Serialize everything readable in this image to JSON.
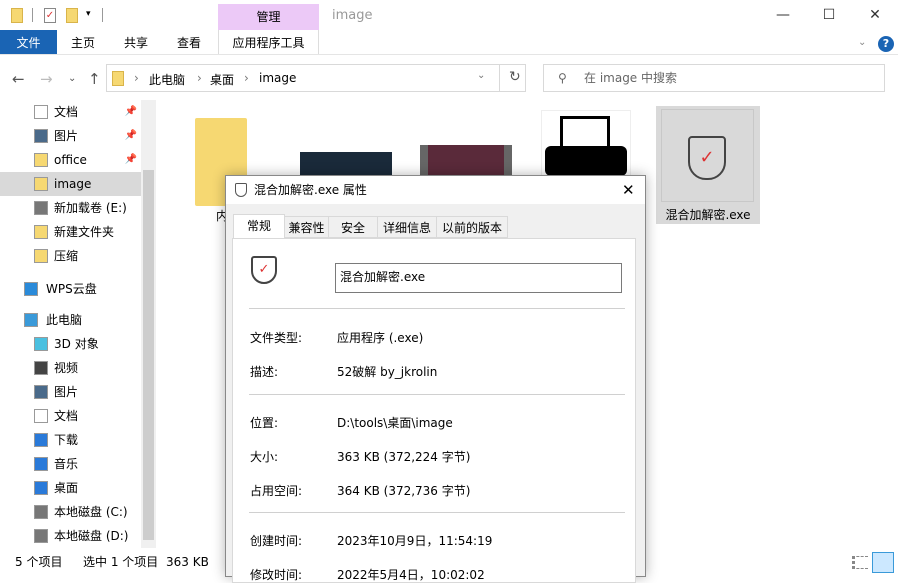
{
  "window": {
    "title": "image",
    "manage_tab": "管理",
    "minimize": "—",
    "maximize": "☐",
    "close": "✕"
  },
  "ribbon": {
    "tabs": [
      "文件",
      "主页",
      "共享",
      "查看"
    ],
    "app_tools": "应用程序工具",
    "help": "?"
  },
  "address": {
    "crumbs": [
      "此电脑",
      "桌面",
      "image"
    ],
    "search_placeholder": "在 image 中搜索"
  },
  "sidebar": {
    "items": [
      {
        "label": "文档",
        "icon": "document-icon",
        "pinned": true
      },
      {
        "label": "图片",
        "icon": "picture-icon",
        "pinned": true
      },
      {
        "label": "office",
        "icon": "folder-icon",
        "pinned": true
      },
      {
        "label": "image",
        "icon": "folder-icon",
        "selected": true
      },
      {
        "label": "新加载卷 (E:)",
        "icon": "drive-icon"
      },
      {
        "label": "新建文件夹",
        "icon": "folder-icon"
      },
      {
        "label": "压缩",
        "icon": "folder-icon"
      },
      {
        "label": "WPS云盘",
        "icon": "cloud-icon"
      },
      {
        "label": "此电脑",
        "icon": "computer-icon"
      },
      {
        "label": "3D 对象",
        "icon": "cube-icon"
      },
      {
        "label": "视频",
        "icon": "video-icon"
      },
      {
        "label": "图片",
        "icon": "picture-icon"
      },
      {
        "label": "文档",
        "icon": "document-icon"
      },
      {
        "label": "下载",
        "icon": "download-icon"
      },
      {
        "label": "音乐",
        "icon": "music-icon"
      },
      {
        "label": "桌面",
        "icon": "desktop-icon"
      },
      {
        "label": "本地磁盘 (C:)",
        "icon": "drive-icon"
      },
      {
        "label": "本地磁盘 (D:)",
        "icon": "drive-icon"
      }
    ]
  },
  "files": {
    "folder_label_partial": "内",
    "exe_label": "混合加解密.exe"
  },
  "status": {
    "count": "5 个项目",
    "selected": "选中 1 个项目",
    "size": "363 KB"
  },
  "dialog": {
    "title": "混合加解密.exe 属性",
    "tabs": [
      "常规",
      "兼容性",
      "安全",
      "详细信息",
      "以前的版本"
    ],
    "filename": "混合加解密.exe",
    "rows": [
      {
        "label": "文件类型:",
        "value": "应用程序 (.exe)"
      },
      {
        "label": "描述:",
        "value": "52破解 by_jkrolin"
      },
      {
        "label": "位置:",
        "value": "D:\\tools\\桌面\\image"
      },
      {
        "label": "大小:",
        "value": "363 KB (372,224 字节)"
      },
      {
        "label": "占用空间:",
        "value": "364 KB (372,736 字节)"
      },
      {
        "label": "创建时间:",
        "value": "2023年10月9日，11:54:19"
      },
      {
        "label": "修改时间:",
        "value": "2022年5月4日，10:02:02"
      }
    ]
  }
}
